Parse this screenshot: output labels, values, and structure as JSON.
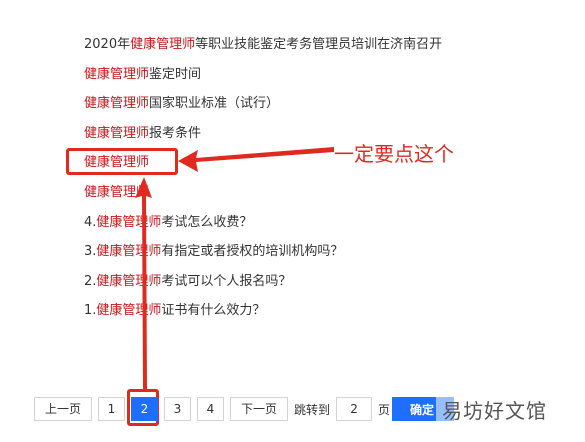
{
  "results": [
    {
      "parts": [
        {
          "text": "2020年",
          "hl": false
        },
        {
          "text": "健康管理师",
          "hl": true
        },
        {
          "text": "等职业技能鉴定考务管理员培训在济南召开",
          "hl": false
        }
      ]
    },
    {
      "parts": [
        {
          "text": "健康管理师",
          "hl": true
        },
        {
          "text": "鉴定时间",
          "hl": false
        }
      ]
    },
    {
      "parts": [
        {
          "text": "健康管理师",
          "hl": true
        },
        {
          "text": "国家职业标准（试行）",
          "hl": false
        }
      ]
    },
    {
      "parts": [
        {
          "text": "健康管理师",
          "hl": true
        },
        {
          "text": "报考条件",
          "hl": false
        }
      ]
    },
    {
      "parts": [
        {
          "text": "健康管理师",
          "hl": true
        }
      ]
    },
    {
      "parts": [
        {
          "text": "健康管理师",
          "hl": true
        }
      ]
    },
    {
      "parts": [
        {
          "text": "4.",
          "hl": false
        },
        {
          "text": "健康管理师",
          "hl": true
        },
        {
          "text": "考试怎么收费？",
          "hl": false
        }
      ]
    },
    {
      "parts": [
        {
          "text": "3.",
          "hl": false
        },
        {
          "text": "健康管理师",
          "hl": true
        },
        {
          "text": "有指定或者授权的培训机构吗？",
          "hl": false
        }
      ]
    },
    {
      "parts": [
        {
          "text": "2.",
          "hl": false
        },
        {
          "text": "健康管理师",
          "hl": true
        },
        {
          "text": "考试可以个人报名吗？",
          "hl": false
        }
      ]
    },
    {
      "parts": [
        {
          "text": "1.",
          "hl": false
        },
        {
          "text": "健康管理师",
          "hl": true
        },
        {
          "text": "证书有什么效力？",
          "hl": false
        }
      ]
    }
  ],
  "annotation": {
    "callout_text": "一定要点这个",
    "color": "#e02a20"
  },
  "pagination": {
    "prev_label": "上一页",
    "pages": [
      "1",
      "2",
      "3",
      "4"
    ],
    "current_page": "2",
    "next_label": "下一页",
    "jump_label": "跳转到",
    "jump_value": "2",
    "page_suffix": "页",
    "confirm_label": "确定"
  },
  "watermark": {
    "text": "易坊好文馆"
  },
  "colors": {
    "highlight_text": "#c8161d",
    "active_page": "#1e6fff",
    "confirm_button": "#1e6fff"
  }
}
